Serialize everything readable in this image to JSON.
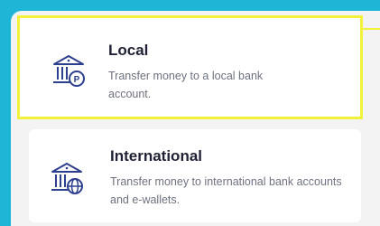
{
  "options": [
    {
      "title": "Local",
      "description": "Transfer money to a local bank account.",
      "icon": "bank-local-icon"
    },
    {
      "title": "International",
      "description": "Transfer money to international bank accounts and e-wallets.",
      "icon": "bank-international-icon"
    }
  ],
  "colors": {
    "background": "#1fb5d6",
    "highlight": "#f2f23a",
    "icon": "#2d3f8f",
    "title": "#1f2235",
    "description": "#6e7180"
  }
}
